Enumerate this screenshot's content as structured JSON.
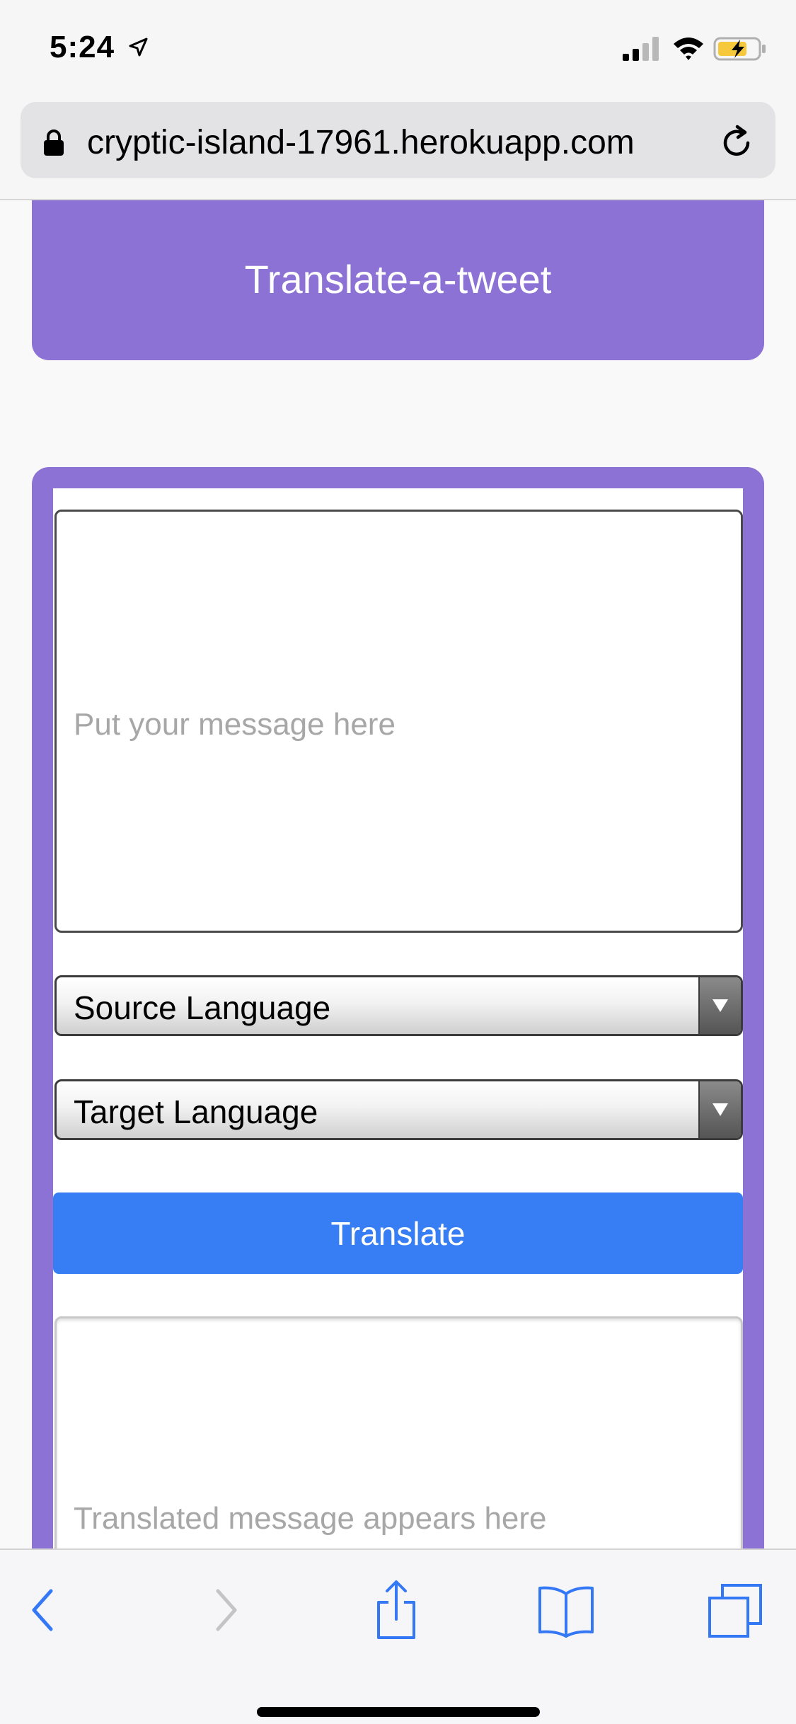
{
  "status_bar": {
    "time": "5:24",
    "icons": [
      "location-arrow-icon",
      "cellular-signal-icon",
      "wifi-icon",
      "battery-charging-icon"
    ],
    "battery_color": "#f5c93b"
  },
  "browser": {
    "url": "cryptic-island-17961.herokuapp.com",
    "icons": [
      "lock-icon",
      "reload-icon"
    ]
  },
  "header": {
    "title": "Translate-a-tweet"
  },
  "form": {
    "message_placeholder": "Put your message here",
    "source_language": "Source Language",
    "target_language": "Target Language",
    "translate_label": "Translate",
    "output_placeholder": "Translated message appears here"
  },
  "toolbar": {
    "icons": [
      "back-icon",
      "forward-icon",
      "share-icon",
      "bookmarks-icon",
      "tabs-icon"
    ]
  },
  "colors": {
    "accent_purple": "#8c72d5",
    "button_blue": "#377df3",
    "toolbar_icon_blue": "#3478f6",
    "placeholder_gray": "#a7a7a7"
  }
}
